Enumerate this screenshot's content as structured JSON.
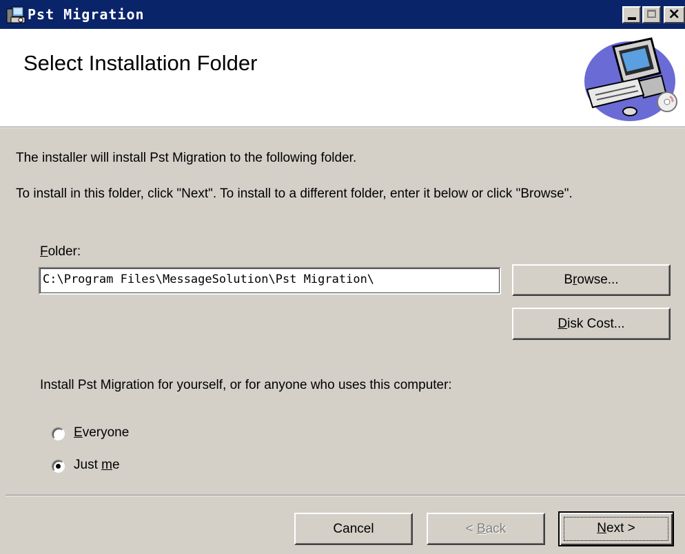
{
  "window": {
    "title": "Pst Migration",
    "buttons": {
      "minimize": "minimize",
      "maximize": "maximize",
      "close": "×"
    }
  },
  "banner": {
    "heading": "Select Installation Folder"
  },
  "body": {
    "intro": "The installer will install Pst Migration to the following folder.",
    "instructions": "To install in this folder, click \"Next\". To install to a different folder, enter it below or click \"Browse\".",
    "folder_label_first": "F",
    "folder_label_rest": "older:",
    "folder_value": "C:\\Program Files\\MessageSolution\\Pst Migration\\",
    "browse_pre": "B",
    "browse_ul": "r",
    "browse_post": "owse...",
    "diskcost_ul": "D",
    "diskcost_post": "isk Cost...",
    "who_label": "Install Pst Migration for yourself, or for anyone who uses this computer:",
    "radio_everyone_ul": "E",
    "radio_everyone_post": "veryone",
    "radio_justme_pre": "Just ",
    "radio_justme_ul": "m",
    "radio_justme_post": "e",
    "selected": "Just me"
  },
  "footer": {
    "cancel": "Cancel",
    "back_pre": "< ",
    "back_ul": "B",
    "back_post": "ack",
    "next_ul": "N",
    "next_post": "ext >"
  },
  "colors": {
    "titlebar": "#0a246a",
    "face": "#d4d0c8",
    "banner": "#ffffff"
  }
}
